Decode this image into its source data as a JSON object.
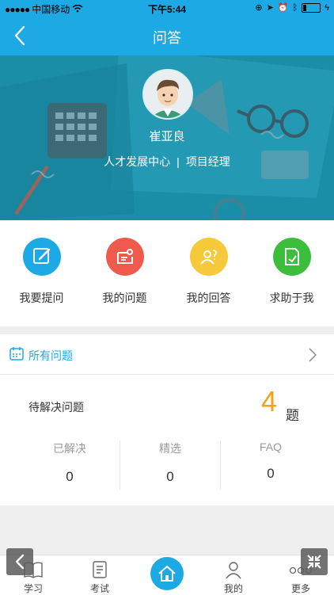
{
  "status_bar": {
    "carrier": "中国移动",
    "time": "下午5:44"
  },
  "nav": {
    "title": "问答"
  },
  "profile": {
    "name": "崔亚良",
    "department": "人才发展中心",
    "separator": "|",
    "role": "项目经理"
  },
  "actions": [
    {
      "label": "我要提问",
      "color": "#1da9e4",
      "icon": "edit-icon"
    },
    {
      "label": "我的问题",
      "color": "#ef5a4c",
      "icon": "user-question-icon"
    },
    {
      "label": "我的回答",
      "color": "#f5c93a",
      "icon": "answer-icon"
    },
    {
      "label": "求助于我",
      "color": "#3cbd3c",
      "icon": "help-icon"
    }
  ],
  "questions": {
    "all_label": "所有问题",
    "pending_label": "待解决问题",
    "pending_count": "4",
    "pending_unit": "题",
    "stats": [
      {
        "label": "已解决",
        "value": "0"
      },
      {
        "label": "精选",
        "value": "0"
      },
      {
        "label": "FAQ",
        "value": "0"
      }
    ]
  },
  "tabbar": {
    "items": [
      {
        "label": "学习",
        "icon": "book-icon"
      },
      {
        "label": "考试",
        "icon": "exam-icon"
      },
      {
        "label": "",
        "icon": "home-icon"
      },
      {
        "label": "我的",
        "icon": "person-icon"
      },
      {
        "label": "更多",
        "icon": "more-icon"
      }
    ]
  },
  "colors": {
    "primary": "#1da9e4",
    "hero": "#1a8fa8",
    "accent_number": "#f3a21a"
  }
}
